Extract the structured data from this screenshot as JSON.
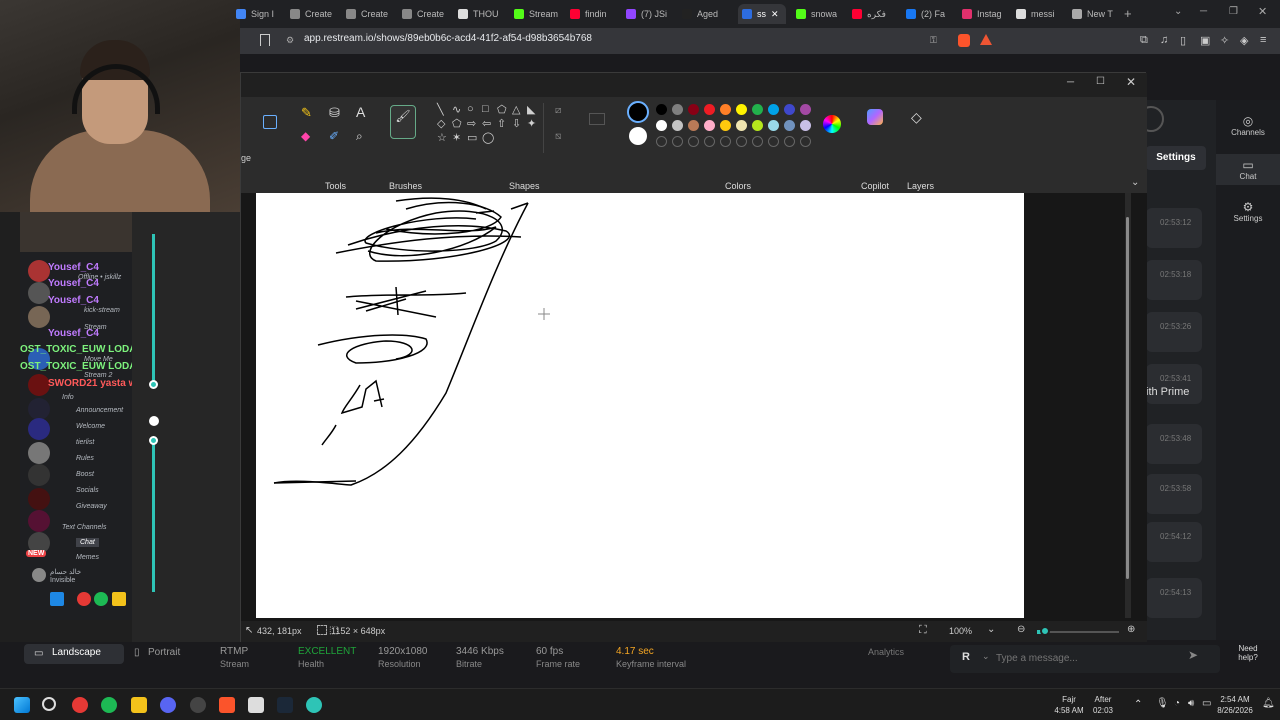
{
  "browser": {
    "tabs": [
      {
        "label": "Sign I",
        "color": "#4285f4"
      },
      {
        "label": "Create",
        "color": "#888"
      },
      {
        "label": "Create",
        "color": "#888"
      },
      {
        "label": "Create",
        "color": "#888"
      },
      {
        "label": "THOU",
        "color": "#ddd"
      },
      {
        "label": "Stream",
        "color": "#53fc18"
      },
      {
        "label": "findin",
        "color": "#ff0033"
      },
      {
        "label": "(7) JSi",
        "color": "#9146ff"
      },
      {
        "label": "Aged",
        "color": "#222"
      },
      {
        "label": "ss",
        "color": "#2d6cdf"
      },
      {
        "label": "snowa",
        "color": "#53fc18"
      },
      {
        "label": "فكره",
        "color": "#ff0033"
      },
      {
        "label": "(2) Fa",
        "color": "#1877f2"
      },
      {
        "label": "Instag",
        "color": "#e1306c"
      },
      {
        "label": "messi",
        "color": "#ddd"
      },
      {
        "label": "New T",
        "color": "#aaa"
      }
    ],
    "url": "app.restream.io/shows/89eb0b6c-acd4-41f2-af54-d98b3654b768",
    "new_tab": "+"
  },
  "paint": {
    "groups": {
      "tools": "Tools",
      "brushes": "Brushes",
      "shapes": "Shapes",
      "colors": "Colors",
      "copilot": "Copilot",
      "layers": "Layers"
    },
    "palette_row1": [
      "#000000",
      "#7f7f7f",
      "#880015",
      "#ed1c24",
      "#ff7f27",
      "#fff200",
      "#22b14c",
      "#00a2e8",
      "#3f48cc",
      "#a349a4"
    ],
    "palette_row2": [
      "#ffffff",
      "#c3c3c3",
      "#b97a57",
      "#ffaec9",
      "#ffc90e",
      "#efe4b0",
      "#b5e61d",
      "#99d9ea",
      "#7092be",
      "#c8bfe7"
    ],
    "status": {
      "cursor": "432, 181px",
      "size": "1152 × 648px",
      "zoom": "100%"
    },
    "edge_label": "ge"
  },
  "chat": {
    "lines": [
      {
        "text": "Yousef_C4",
        "style": "p"
      },
      {
        "text": "Yousef_C4",
        "style": "p"
      },
      {
        "text": "Yousef_C4",
        "style": "p"
      },
      {
        "text": "Yousef_C4",
        "style": "p"
      },
      {
        "text": "OST_TOXIC_EUW  LODAA",
        "style": "g"
      },
      {
        "text": "OST_TOXIC_EUW  LODAA",
        "style": "g"
      },
      {
        "text": "SWORD21  yasta w",
        "style": "r"
      }
    ],
    "channels": [
      "Announcement",
      "Welcome",
      "tierlist",
      "Rules",
      "Boost",
      "Socials",
      "Giveaway",
      "Chat",
      "Memes"
    ],
    "small": [
      "Offline • jskillz",
      "kick-stream",
      "Stream",
      "Move Me",
      "Stream 2"
    ],
    "section": "Text Channels",
    "user": "خالد حسام",
    "user_status": "Invisible",
    "new_badge": "NEW",
    "info": "Info"
  },
  "restream": {
    "settings_label": "Settings",
    "timestamps": [
      "02:53:12",
      "02:53:18",
      "02:53:26",
      "02:53:41",
      "02:53:48",
      "02:53:58",
      "02:54:12",
      "02:54:13"
    ],
    "prime_text": "ith Prime",
    "nav": [
      {
        "label": "Channels"
      },
      {
        "label": "Chat"
      },
      {
        "label": "Settings"
      }
    ],
    "layout_landscape": "Landscape",
    "layout_portrait": "Portrait",
    "stats": [
      {
        "value": "RTMP",
        "label": "Stream"
      },
      {
        "value": "EXCELLENT",
        "label": "Health"
      },
      {
        "value": "1920x1080",
        "label": "Resolution"
      },
      {
        "value": "3446 Kbps",
        "label": "Bitrate"
      },
      {
        "value": "60 fps",
        "label": "Frame rate"
      },
      {
        "value": "4.17 sec",
        "label": "Keyframe interval"
      }
    ],
    "analytics": "Analytics",
    "message_placeholder": "Type a message...",
    "avatar_letter": "R",
    "need_help": "Need help?"
  },
  "taskbar": {
    "prayer_name": "Fajr",
    "prayer_time": "4:58 AM",
    "after_label": "After",
    "after_value": "02:03",
    "time": "2:54 AM",
    "date": "8/26/2026"
  }
}
